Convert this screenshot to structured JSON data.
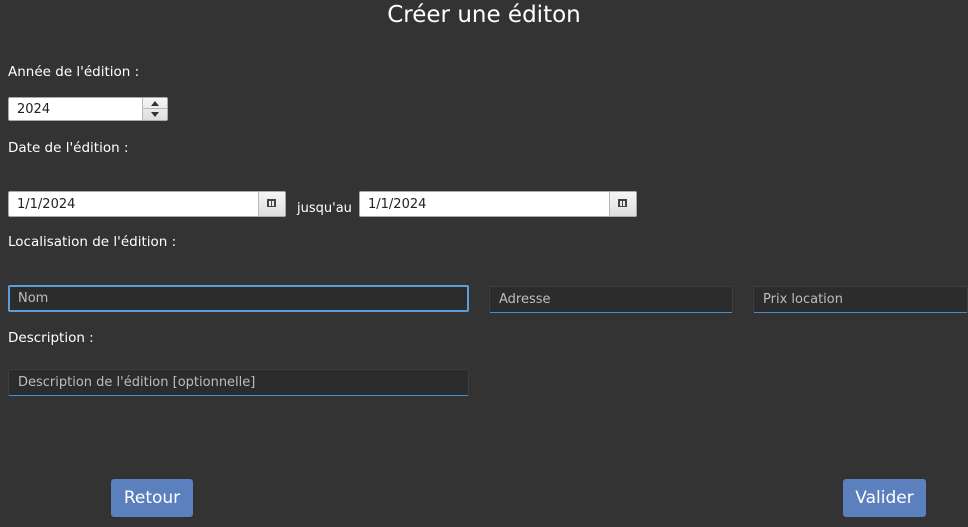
{
  "title": "Créer une éditon",
  "year": {
    "label": "Année de l'édition :",
    "value": "2024"
  },
  "date": {
    "label": "Date de l'édition :",
    "start": "1/1/2024",
    "separator": "jusqu'au",
    "end": "1/1/2024"
  },
  "location": {
    "label": "Localisation de l'édition :",
    "name_placeholder": "Nom",
    "address_placeholder": "Adresse",
    "price_placeholder": "Prix location"
  },
  "description": {
    "label": "Description :",
    "placeholder": "Description de l'édition [optionnelle]"
  },
  "buttons": {
    "back": "Retour",
    "submit": "Valider"
  },
  "colors": {
    "background": "#333333",
    "accent": "#3d8fd6",
    "button": "#5b80bd"
  }
}
